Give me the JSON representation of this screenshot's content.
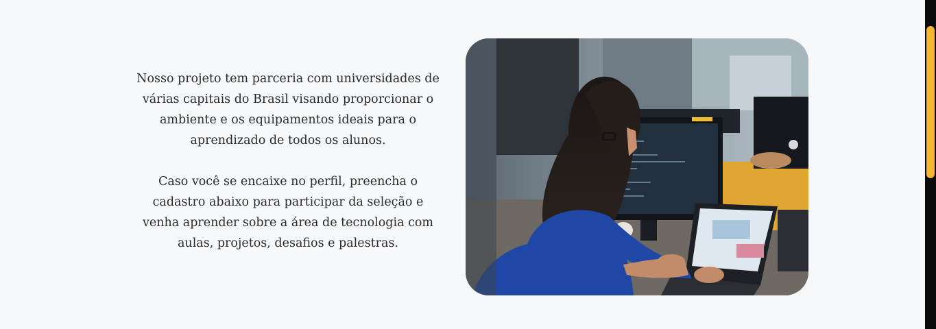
{
  "content": {
    "paragraphs": [
      "Nosso projeto tem parceria com universidades de várias capitais do Brasil visando proporcionar o ambiente e os equipamentos ideais para o aprendizado de todos os alunos.",
      "Caso você se encaixe no perfil, preencha o cadastro abaixo para participar da seleção e venha aprender sobre a área de tecnologia com aulas, projetos, desafios e palestras."
    ]
  },
  "image": {
    "icon": "photo-woman-coding-at-computer"
  },
  "colors": {
    "background": "#f7f8fa",
    "text": "#2b2b2b",
    "scrollbar_thumb": "#f5b731",
    "scrollbar_track": "#0a0a0a"
  }
}
